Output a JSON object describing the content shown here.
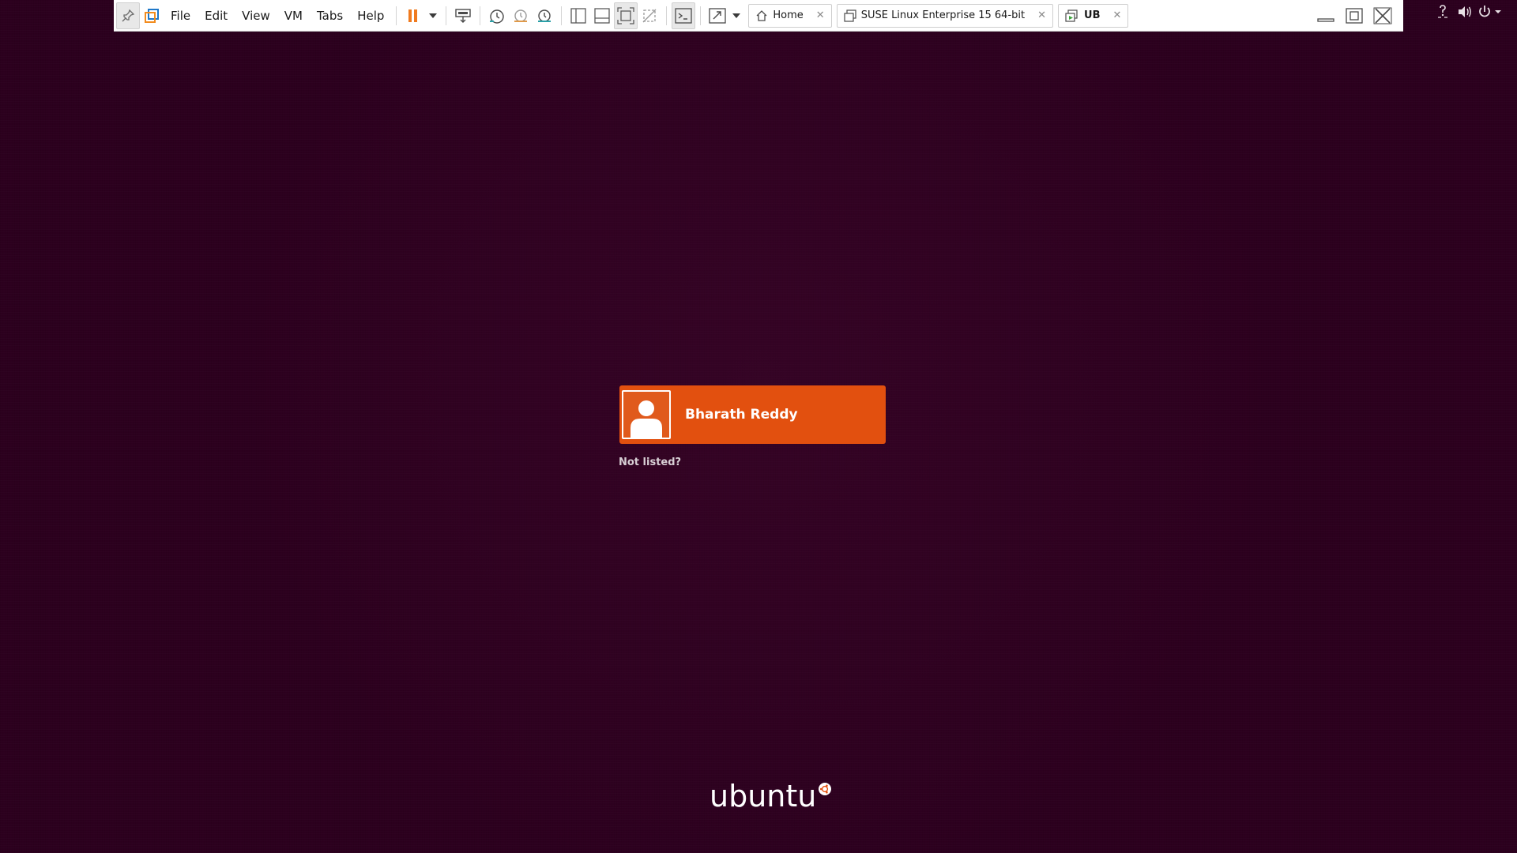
{
  "toolbar": {
    "menus": [
      "File",
      "Edit",
      "View",
      "VM",
      "Tabs",
      "Help"
    ],
    "tabs": [
      {
        "label": "Home",
        "icon": "home-icon",
        "active": false
      },
      {
        "label": "SUSE Linux Enterprise 15 64-bit",
        "icon": "vm-tab-icon",
        "active": false
      },
      {
        "label": "UB",
        "icon": "vm-running-tab-icon",
        "active": true
      }
    ],
    "close_glyph": "✕",
    "colors": {
      "pause": "#f07a1e",
      "snapshot_accent": "#2aa0a8"
    }
  },
  "panel": {
    "indicators": [
      "accessibility-icon",
      "volume-icon",
      "power-icon"
    ]
  },
  "greeter": {
    "user_name": "Bharath Reddy",
    "not_listed": "Not listed?",
    "accent": "#e2500f",
    "background": "#2c001e"
  },
  "branding": {
    "logo_text": "ubuntu"
  }
}
